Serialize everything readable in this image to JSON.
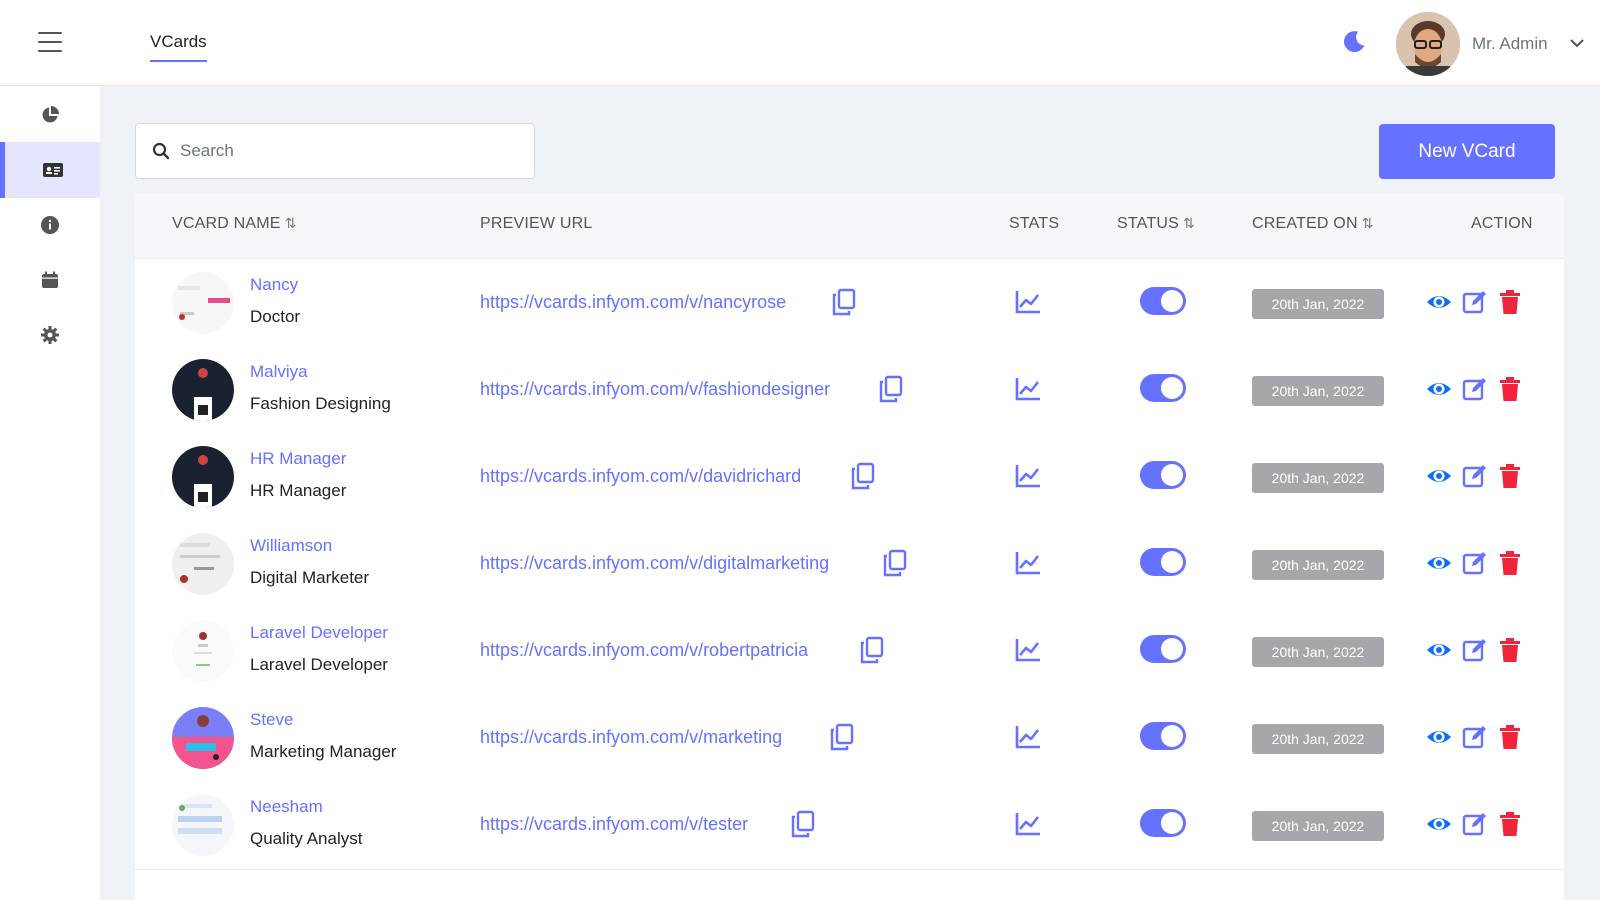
{
  "header": {
    "tab_label": "VCards",
    "admin_name": "Mr. Admin"
  },
  "sidebar": {
    "items": [
      {
        "icon": "pie-chart-icon",
        "active": false
      },
      {
        "icon": "id-card-icon",
        "active": true
      },
      {
        "icon": "info-icon",
        "active": false
      },
      {
        "icon": "calendar-icon",
        "active": false
      },
      {
        "icon": "gear-icon",
        "active": false
      }
    ]
  },
  "search": {
    "placeholder": "Search"
  },
  "new_button": {
    "label": "New VCard"
  },
  "table": {
    "headers": {
      "name": "VCARD NAME",
      "url": "PREVIEW URL",
      "stats": "STATS",
      "status": "STATUS",
      "created": "CREATED ON",
      "action": "ACTION"
    },
    "rows": [
      {
        "name": "Nancy",
        "occupation": "Doctor",
        "url": "https://vcards.infyom.com/v/nancyrose",
        "status": true,
        "created": "20th Jan, 2022"
      },
      {
        "name": "Malviya",
        "occupation": "Fashion Designing",
        "url": "https://vcards.infyom.com/v/fashiondesigner",
        "status": true,
        "created": "20th Jan, 2022"
      },
      {
        "name": "HR Manager",
        "occupation": "HR Manager",
        "url": "https://vcards.infyom.com/v/davidrichard",
        "status": true,
        "created": "20th Jan, 2022"
      },
      {
        "name": "Williamson",
        "occupation": "Digital Marketer",
        "url": "https://vcards.infyom.com/v/digitalmarketing",
        "status": true,
        "created": "20th Jan, 2022"
      },
      {
        "name": "Laravel Developer",
        "occupation": "Laravel Developer",
        "url": "https://vcards.infyom.com/v/robertpatricia",
        "status": true,
        "created": "20th Jan, 2022"
      },
      {
        "name": "Steve",
        "occupation": "Marketing Manager",
        "url": "https://vcards.infyom.com/v/marketing",
        "status": true,
        "created": "20th Jan, 2022"
      },
      {
        "name": "Neesham",
        "occupation": "Quality Analyst",
        "url": "https://vcards.infyom.com/v/tester",
        "status": true,
        "created": "20th Jan, 2022"
      }
    ]
  },
  "colors": {
    "accent": "#6571ff",
    "view": "#0d6efd",
    "delete": "#f0243a",
    "date_badge": "#a5a7ab"
  }
}
